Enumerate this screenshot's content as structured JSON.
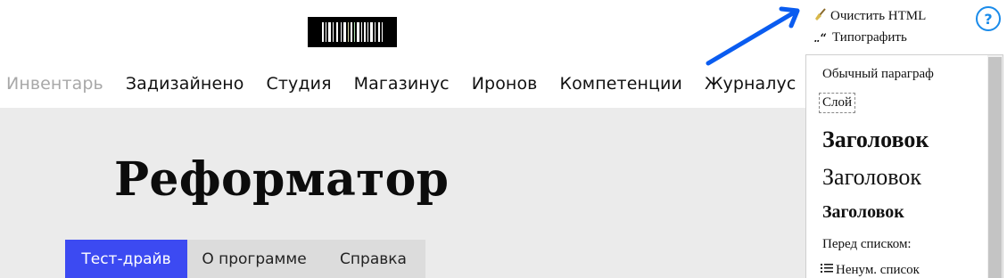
{
  "logo": {
    "icon": "barcode-logo"
  },
  "nav": {
    "items": [
      "Инвентарь",
      "Задизайнено",
      "Студия",
      "Магазинус",
      "Иронов",
      "Компетенции",
      "Журналус"
    ]
  },
  "main": {
    "title": "Реформатор",
    "tabs": [
      "Тест-драйв",
      "О программе",
      "Справка"
    ],
    "active_tab": "Тест-драйв"
  },
  "toolbar": {
    "clean_label": "Очистить HTML",
    "clean_icon": "broom-icon",
    "typograph_label": "Типографить",
    "typograph_icon": "quotes-icon",
    "help_label": "?"
  },
  "format_panel": {
    "paragraph": "Обычный параграф",
    "layer": "Слой",
    "heading1": "Заголовок",
    "heading2": "Заголовок",
    "heading3": "Заголовок",
    "before_list": "Перед списком:",
    "unordered_list": "Ненум. список"
  },
  "colors": {
    "accent": "#3c4af2",
    "help": "#1a8bea",
    "arrow": "#0a5cf0",
    "content_bg": "#ebebeb"
  }
}
